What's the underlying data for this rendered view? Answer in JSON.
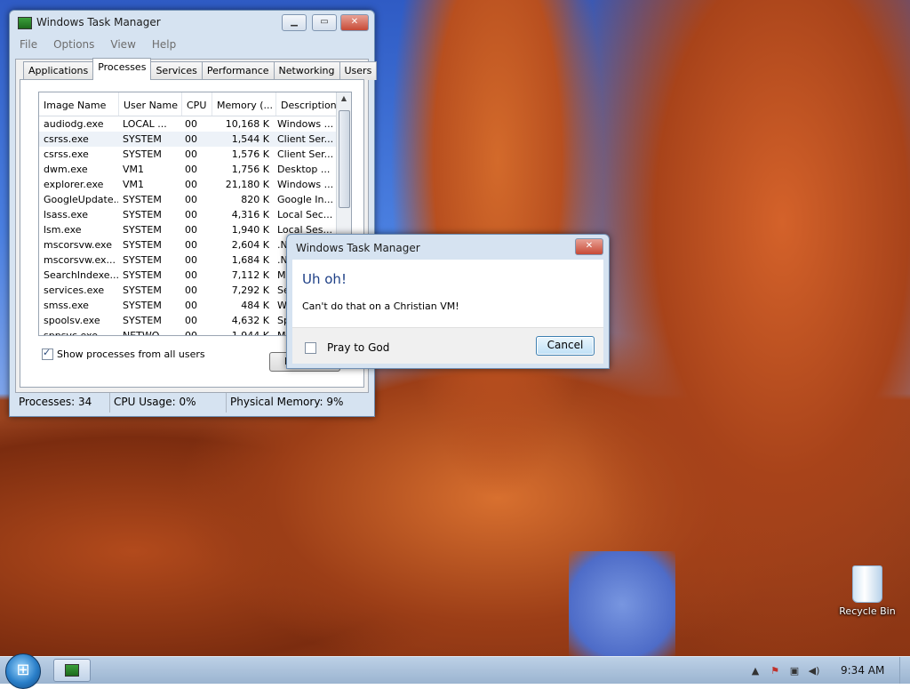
{
  "taskmgr": {
    "title": "Windows Task Manager",
    "menu": [
      "File",
      "Options",
      "View",
      "Help"
    ],
    "tabs": [
      "Applications",
      "Processes",
      "Services",
      "Performance",
      "Networking",
      "Users"
    ],
    "columns": [
      "Image Name",
      "User Name",
      "CPU",
      "Memory (...",
      "Description"
    ],
    "rows": [
      [
        "audiodg.exe",
        "LOCAL ...",
        "00",
        "10,168 K",
        "Windows ..."
      ],
      [
        "csrss.exe",
        "SYSTEM",
        "00",
        "1,544 K",
        "Client Ser..."
      ],
      [
        "csrss.exe",
        "SYSTEM",
        "00",
        "1,576 K",
        "Client Ser..."
      ],
      [
        "dwm.exe",
        "VM1",
        "00",
        "1,756 K",
        "Desktop ..."
      ],
      [
        "explorer.exe",
        "VM1",
        "00",
        "21,180 K",
        "Windows ..."
      ],
      [
        "GoogleUpdate...",
        "SYSTEM",
        "00",
        "820 K",
        "Google In..."
      ],
      [
        "lsass.exe",
        "SYSTEM",
        "00",
        "4,316 K",
        "Local Sec..."
      ],
      [
        "lsm.exe",
        "SYSTEM",
        "00",
        "1,940 K",
        "Local Ses..."
      ],
      [
        "mscorsvw.exe",
        "SYSTEM",
        "00",
        "2,604 K",
        ".NE"
      ],
      [
        "mscorsvw.ex...",
        "SYSTEM",
        "00",
        "1,684 K",
        ".NE"
      ],
      [
        "SearchIndexe...",
        "SYSTEM",
        "00",
        "7,112 K",
        "Mic"
      ],
      [
        "services.exe",
        "SYSTEM",
        "00",
        "7,292 K",
        "Ser"
      ],
      [
        "smss.exe",
        "SYSTEM",
        "00",
        "484 K",
        "Win"
      ],
      [
        "spoolsv.exe",
        "SYSTEM",
        "00",
        "4,632 K",
        "Spo"
      ],
      [
        "sppsvc.exe",
        "NETWO...",
        "00",
        "1,944 K",
        "Mic"
      ]
    ],
    "show_all_label": "Show processes from all users",
    "end_button_label": "E",
    "status": {
      "processes": "Processes: 34",
      "cpu": "CPU Usage: 0%",
      "memory": "Physical Memory: 9%"
    }
  },
  "dialog": {
    "title": "Windows Task Manager",
    "heading": "Uh oh!",
    "message": "Can't do that on a Christian VM!",
    "checkbox_label": "Pray to God",
    "cancel_label": "Cancel"
  },
  "desktop": {
    "recycle_bin_label": "Recycle Bin"
  },
  "taskbar": {
    "clock": "9:34 AM"
  }
}
